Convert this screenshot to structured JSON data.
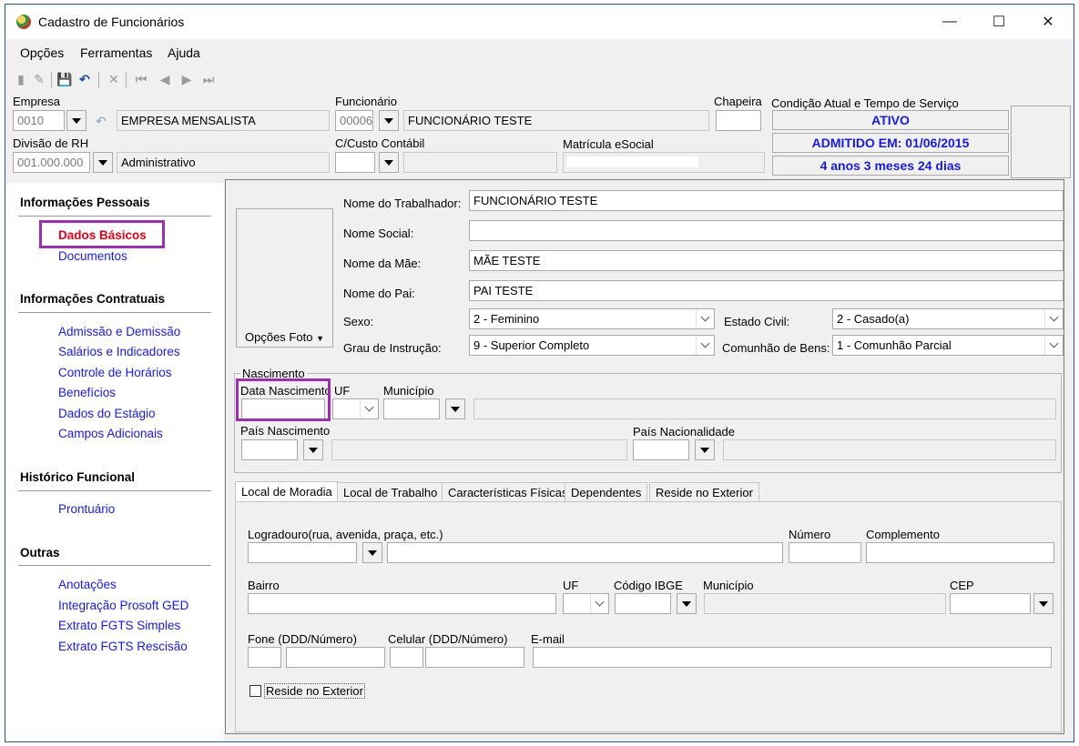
{
  "window": {
    "title": "Cadastro de Funcionários"
  },
  "menu": [
    {
      "label": "Opções"
    },
    {
      "label": "Ferramentas"
    },
    {
      "label": "Ajuda"
    }
  ],
  "header": {
    "empresa_label": "Empresa",
    "empresa_code": "0010",
    "empresa_name": "EMPRESA MENSALISTA",
    "divisao_label": "Divisão de RH",
    "divisao_code": "001.000.000",
    "divisao_name": "Administrativo",
    "funcionario_label": "Funcionário",
    "funcionario_code": "00006",
    "funcionario_name": "FUNCIONÁRIO TESTE",
    "custo_label": "C/Custo Contábil",
    "matricula_label": "Matrícula eSocial",
    "chapeira_label": "Chapeira",
    "condicao_label": "Condição Atual e Tempo de Serviço",
    "status_ativo": "ATIVO",
    "status_admitido": "ADMITIDO EM: 01/06/2015",
    "status_tempo": "4 anos 3 meses 24 dias"
  },
  "sidebar": {
    "sections": [
      {
        "title": "Informações Pessoais",
        "items": [
          "Dados Básicos",
          "Documentos"
        ]
      },
      {
        "title": "Informações Contratuais",
        "items": [
          "Admissão e Demissão",
          "Salários e Indicadores",
          "Controle de Horários",
          "Benefícios",
          "Dados do Estágio",
          "Campos Adicionais"
        ]
      },
      {
        "title": "Histórico Funcional",
        "items": [
          "Prontuário"
        ]
      },
      {
        "title": "Outras",
        "items": [
          "Anotações",
          "Integração Prosoft GED",
          "Extrato FGTS Simples",
          "Extrato FGTS Rescisão"
        ]
      }
    ],
    "selected": "Dados Básicos"
  },
  "form": {
    "photo_button": "Opções Foto",
    "nome_trabalhador_label": "Nome do Trabalhador:",
    "nome_trabalhador": "FUNCIONÁRIO TESTE",
    "nome_social_label": "Nome Social:",
    "nome_social": "",
    "nome_mae_label": "Nome da Mãe:",
    "nome_mae": "MÃE TESTE",
    "nome_pai_label": "Nome do Pai:",
    "nome_pai": "PAI TESTE",
    "sexo_label": "Sexo:",
    "sexo": "2 - Feminino",
    "estado_civil_label": "Estado Civil:",
    "estado_civil": "2 - Casado(a)",
    "grau_label": "Grau de Instrução:",
    "grau": "9 - Superior Completo",
    "comunhao_label": "Comunhão de Bens:",
    "comunhao": "1 - Comunhão Parcial"
  },
  "nascimento": {
    "legend": "Nascimento",
    "data_label": "Data Nascimento",
    "uf_label": "UF",
    "municipio_label": "Município",
    "pais_nasc_label": "País Nascimento",
    "pais_nac_label": "País Nacionalidade"
  },
  "tabs": [
    "Local de Moradia",
    "Local de Trabalho",
    "Características Físicas",
    "Dependentes",
    "Reside no Exterior"
  ],
  "moradia": {
    "logradouro_label": "Logradouro(rua, avenida, praça, etc.)",
    "numero_label": "Número",
    "complemento_label": "Complemento",
    "bairro_label": "Bairro",
    "uf_label": "UF",
    "ibge_label": "Código IBGE",
    "municipio_label": "Município",
    "cep_label": "CEP",
    "fone_label": "Fone (DDD/Número)",
    "celular_label": "Celular (DDD/Número)",
    "email_label": "E-mail",
    "reside_label": "Reside no Exterior"
  },
  "colors": {
    "link": "#1a1adc",
    "selected_link": "#e0001a",
    "highlight": "#9b2fae"
  }
}
